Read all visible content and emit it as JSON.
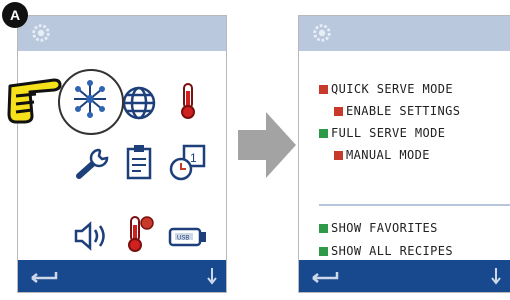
{
  "callout": {
    "label": "A"
  },
  "colors": {
    "red": "#c73a2b",
    "green": "#2e9a47",
    "topbar": "#b9c8dd",
    "bottombar": "#18498f"
  },
  "left_screen": {
    "icons": [
      "network-icon",
      "globe-icon",
      "thermometer-icon",
      "wrench-icon",
      "clipboard-icon",
      "clock-calendar-icon",
      "speaker-icon",
      "thermometer-alert-icon",
      "usb-drive-icon"
    ],
    "highlighted": "network-icon"
  },
  "right_screen": {
    "menu": [
      {
        "label": "QUICK SERVE MODE",
        "status": "red",
        "indent": false
      },
      {
        "label": "ENABLE SETTINGS",
        "status": "red",
        "indent": true
      },
      {
        "label": "FULL SERVE MODE",
        "status": "green",
        "indent": false
      },
      {
        "label": "MANUAL MODE",
        "status": "red",
        "indent": true
      },
      {
        "label": "SHOW FAVORITES",
        "status": "green",
        "indent": false
      },
      {
        "label": "SHOW ALL RECIPES",
        "status": "green",
        "indent": false
      }
    ]
  }
}
